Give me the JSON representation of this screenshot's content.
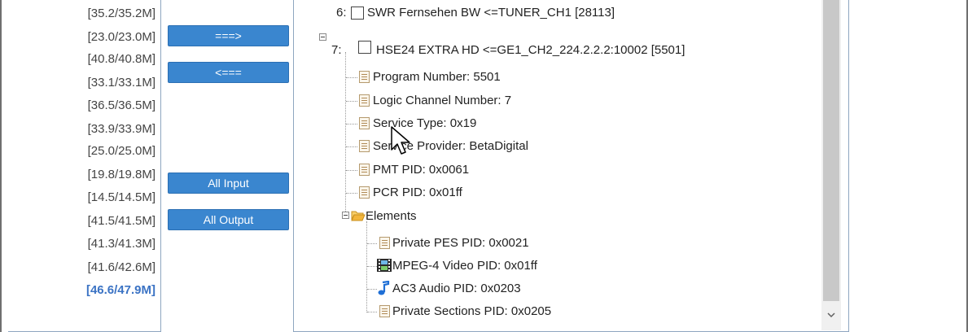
{
  "bitrates": [
    {
      "label": "[35.2/35.2M]"
    },
    {
      "label": "[23.0/23.0M]"
    },
    {
      "label": "[40.8/40.8M]"
    },
    {
      "label": "[33.1/33.1M]"
    },
    {
      "label": "[36.5/36.5M]"
    },
    {
      "label": "[33.9/33.9M]"
    },
    {
      "label": "[25.0/25.0M]"
    },
    {
      "label": "[19.8/19.8M]"
    },
    {
      "label": "[14.5/14.5M]"
    },
    {
      "label": "[41.5/41.5M]"
    },
    {
      "label": "[41.3/41.3M]"
    },
    {
      "label": "[41.6/42.6M]"
    },
    {
      "label": "[46.6/47.9M]"
    }
  ],
  "buttons": {
    "move_right": "===>",
    "move_left": "<===",
    "all_input": "All Input",
    "all_output": "All Output"
  },
  "tree": {
    "prev_program": {
      "index": "6:",
      "label": "SWR Fernsehen BW <=TUNER_CH1 [28113]"
    },
    "program": {
      "index": "7:",
      "label": "HSE24 EXTRA HD <=GE1_CH2_224.2.2.2:10002 [5501]"
    },
    "props": [
      {
        "label": "Program Number: 5501"
      },
      {
        "label": "Logic Channel Number: 7"
      },
      {
        "label": "Service Type: 0x19"
      },
      {
        "label": "Service Provider: BetaDigital"
      },
      {
        "label": "PMT PID: 0x0061"
      },
      {
        "label": "PCR PID: 0x01ff"
      }
    ],
    "elements_label": "Elements",
    "elements": [
      {
        "label": "Private PES PID: 0x0021",
        "icon": "document-icon"
      },
      {
        "label": "MPEG-4 Video PID: 0x01ff",
        "icon": "film-icon"
      },
      {
        "label": "AC3 Audio PID: 0x0203",
        "icon": "music-note-icon"
      },
      {
        "label": "Private Sections PID: 0x0205",
        "icon": "document-icon"
      }
    ]
  },
  "colors": {
    "button_bg": "#3a86cf",
    "highlight_text": "#3b73c4",
    "folder": "#f2b53b"
  }
}
